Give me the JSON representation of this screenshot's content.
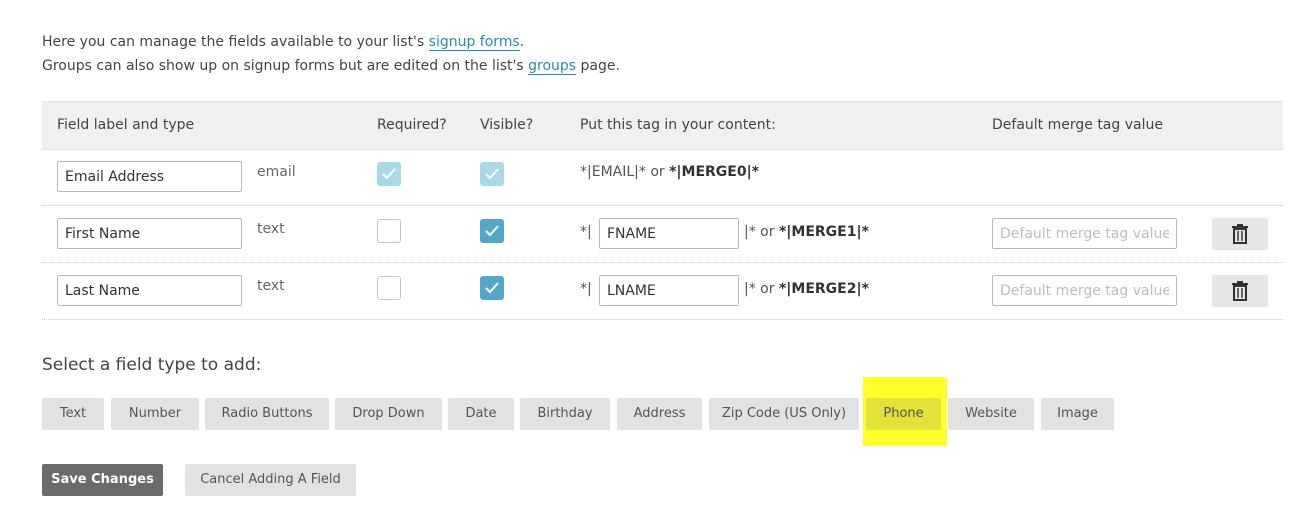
{
  "intro": {
    "line1_prefix": "Here you can manage the fields available to your list's ",
    "line1_link": "signup forms",
    "line1_suffix": ".",
    "line2_prefix": "Groups can also show up on signup forms but are edited on the list's ",
    "line2_link": "groups",
    "line2_suffix": " page."
  },
  "table": {
    "headers": {
      "label": "Field label and type",
      "required": "Required?",
      "visible": "Visible?",
      "tag": "Put this tag in your content:",
      "default": "Default merge tag value"
    },
    "rows": [
      {
        "label_value": "Email Address",
        "type": "email",
        "required": true,
        "required_locked": true,
        "visible": true,
        "visible_locked": true,
        "tag_full": "*|EMAIL|* or ",
        "merge_tag": "*|MERGE0|*"
      },
      {
        "label_value": "First Name",
        "type": "text",
        "required": false,
        "visible": true,
        "tag_prefix": "*|",
        "tag_value": "FNAME",
        "tag_suffix": "|* or ",
        "merge_tag": "*|MERGE1|*",
        "default_placeholder": "Default merge tag value"
      },
      {
        "label_value": "Last Name",
        "type": "text",
        "required": false,
        "visible": true,
        "tag_prefix": "*|",
        "tag_value": "LNAME",
        "tag_suffix": "|* or ",
        "merge_tag": "*|MERGE2|*",
        "default_placeholder": "Default merge tag value"
      }
    ]
  },
  "add_section": {
    "title": "Select a field type to add:",
    "field_types": [
      "Text",
      "Number",
      "Radio Buttons",
      "Drop Down",
      "Date",
      "Birthday",
      "Address",
      "Zip Code (US Only)",
      "Phone",
      "Website",
      "Image"
    ],
    "highlighted": "Phone",
    "highlight_color": "#ffff2a"
  },
  "actions": {
    "save": "Save Changes",
    "cancel": "Cancel Adding A Field"
  },
  "colors": {
    "checkbox_checked": "#52a8c6",
    "checkbox_locked": "#a9d9e8",
    "link": "#2a8ab0",
    "save_button": "#6b6b6b"
  },
  "icons": {
    "checkmark": "check-icon",
    "delete": "trash-icon"
  }
}
